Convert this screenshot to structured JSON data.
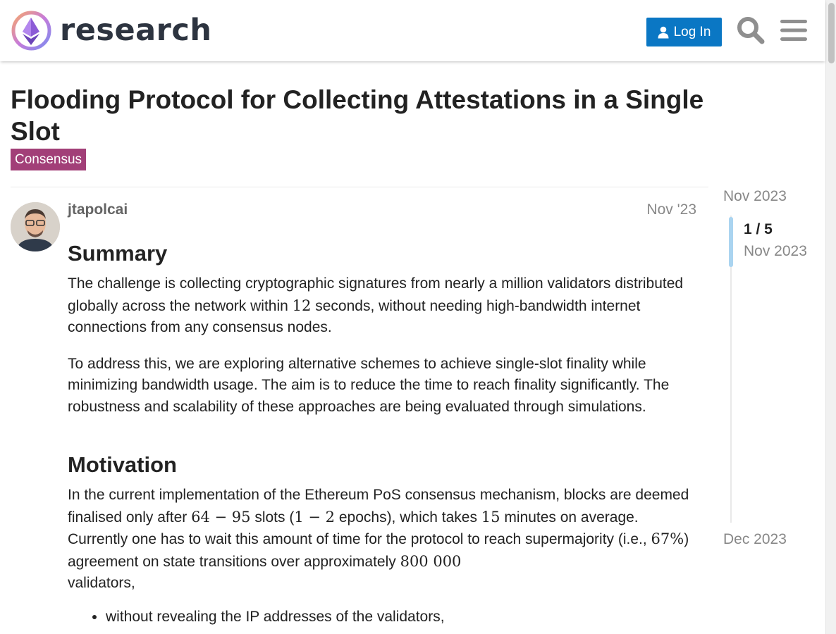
{
  "header": {
    "logo_text": "research",
    "login_label": "Log In",
    "brand_color": "#0a77c4"
  },
  "topic": {
    "title": "Flooding Protocol for Collecting Attestations in a Single Slot",
    "category": "Consensus",
    "category_color": "#a23f78"
  },
  "post": {
    "username": "jtapolcai",
    "date": "Nov '23",
    "summary_heading": "Summary",
    "p1_a": "The challenge is collecting cryptographic signatures from nearly a million validators distributed globally across the network within ",
    "p1_math": "12",
    "p1_b": " seconds, without needing high-bandwidth internet connections from any consensus nodes.",
    "p2": "To address this, we are exploring alternative schemes to achieve single-slot finality while minimizing bandwidth usage. The aim is to reduce the time to reach finality significantly. The robustness and scalability of these approaches are being evaluated through simulations.",
    "motivation_heading": "Motivation",
    "p3_a": "In the current implementation of the Ethereum PoS consensus mechanism, blocks are deemed finalised only after ",
    "p3_m1": "64 − 95",
    "p3_b": " slots (",
    "p3_m2": "1 − 2",
    "p3_c": " epochs), which takes ",
    "p3_m3": "15",
    "p3_d": " minutes on average. Currently one has to wait this amount of time for the protocol to reach supermajority (i.e., ",
    "p3_m4": "67%",
    "p3_e": ") agreement on state transitions over approximately ",
    "p3_m5": "800 000",
    "p3_f": " validators,",
    "bullet1": "without revealing the IP addresses of the validators,"
  },
  "timeline": {
    "start": "Nov 2023",
    "position": "1 / 5",
    "current_date": "Nov 2023",
    "end": "Dec 2023"
  }
}
